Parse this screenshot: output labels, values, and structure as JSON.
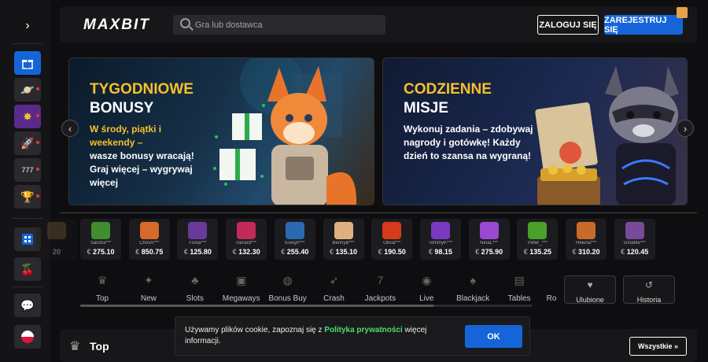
{
  "header": {
    "logo": "MAXBIT",
    "search_placeholder": "Gra lub dostawca",
    "login_label": "ZALOGUJ SIĘ",
    "register_label": "ZAREJESTRUJ SIĘ"
  },
  "sidebar": {
    "toggle_icon": "chevron-right-icon",
    "items": [
      {
        "icon": "gift-icon",
        "active": true
      },
      {
        "icon": "planet-icon"
      },
      {
        "icon": "star-badge-icon"
      },
      {
        "icon": "rocket-icon"
      },
      {
        "icon": "slot-777-icon"
      },
      {
        "icon": "trophy-icon"
      },
      {
        "icon": "grid-icon"
      },
      {
        "icon": "cherry-icon"
      },
      {
        "icon": "chat-icon"
      },
      {
        "icon": "poland-flag-icon"
      }
    ]
  },
  "banners": [
    {
      "title_line1": "TYGODNIOWE",
      "title_line2": "BONUSY",
      "text_highlight": "W środy, piątki i weekendy –",
      "text_rest": "wasze bonusy wracają! Graj więcej – wygrywaj więcej"
    },
    {
      "title_line1": "CODZIENNE",
      "title_line2": "MISJE",
      "text": "Wykonuj zadania – zdobywaj nagrody i gotówkę! Każdy dzień to szansa na wygraną!"
    }
  ],
  "winners": [
    {
      "name": "",
      "amount": "20",
      "color": "#8a6a40"
    },
    {
      "name": "Sandra***",
      "amount": "275.10",
      "color": "#3f8f2e"
    },
    {
      "name": "ChrisA***",
      "amount": "850.75",
      "color": "#d66a2a"
    },
    {
      "name": "Fiona***",
      "amount": "125.80",
      "color": "#6a3a9a"
    },
    {
      "name": "Gerard***",
      "amount": "132.30",
      "color": "#c22a5a"
    },
    {
      "name": "Evelyn***",
      "amount": "255.40",
      "color": "#2a6ab0"
    },
    {
      "name": "BennyB***",
      "amount": "135.10",
      "color": "#e0b080"
    },
    {
      "name": "Olivia***",
      "amount": "190.50",
      "color": "#d63a1a"
    },
    {
      "name": "TommyK***",
      "amount": "98.15",
      "color": "#7a3ac0"
    },
    {
      "name": "NinaL***",
      "amount": "275.90",
      "color": "#9a4ad0"
    },
    {
      "name": "Peter_***",
      "amount": "135.25",
      "color": "#4aa02a"
    },
    {
      "name": "Helena***",
      "amount": "310.20",
      "color": "#c86a2a"
    },
    {
      "name": "GinaMe***",
      "amount": "120.45",
      "color": "#7a4a9a"
    }
  ],
  "currency": "€",
  "categories": [
    {
      "label": "Top",
      "icon": "crown-icon"
    },
    {
      "label": "New",
      "icon": "flame-icon"
    },
    {
      "label": "Slots",
      "icon": "cherry-icon"
    },
    {
      "label": "Megaways",
      "icon": "slot-777-icon"
    },
    {
      "label": "Bonus Buy",
      "icon": "money-bag-icon"
    },
    {
      "label": "Crash",
      "icon": "rocket-icon"
    },
    {
      "label": "Jackpots",
      "icon": "seven-icon"
    },
    {
      "label": "Live",
      "icon": "live-icon"
    },
    {
      "label": "Blackjack",
      "icon": "cards-icon"
    },
    {
      "label": "Tables",
      "icon": "table-card-icon"
    },
    {
      "label": "Ro",
      "icon": ""
    }
  ],
  "quick_links": [
    {
      "label": "Ulubione",
      "icon": "heart-icon"
    },
    {
      "label": "Historia",
      "icon": "history-icon"
    }
  ],
  "section": {
    "title": "Top",
    "all_label": "Wszystkie"
  },
  "cookie": {
    "text_before": "Używamy plików cookie, zapoznaj się z ",
    "link": "Polityka prywatności",
    "text_after": " więcej informacji.",
    "ok_label": "OK"
  }
}
